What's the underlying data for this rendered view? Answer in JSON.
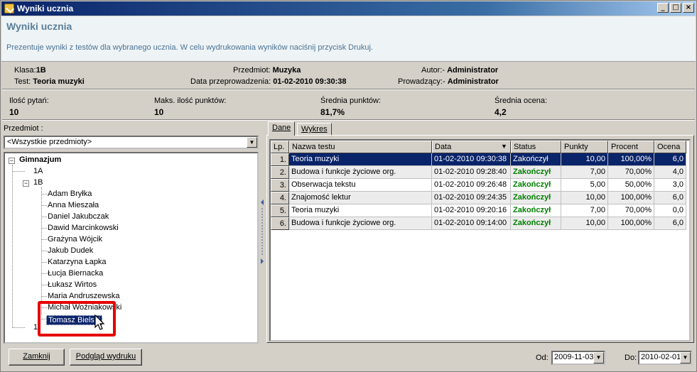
{
  "window": {
    "title": "Wyniki ucznia",
    "min": "_",
    "max": "□",
    "close": "×"
  },
  "header": {
    "title": "Wyniki ucznia",
    "description": "Prezentuje wyniki z testów dla wybranego ucznia. W celu wydrukowania wyników naciśnij przycisk Drukuj."
  },
  "info": {
    "klasa_label": "Klasa:",
    "klasa_value": "1B",
    "test_label": "Test:",
    "test_value": "Teoria muzyki",
    "przedmiot_label": "Przedmiot:",
    "przedmiot_value": "Muzyka",
    "data_label": "Data przeprowadzenia:",
    "data_value": "01-02-2010 09:30:38",
    "autor_label": "Autor:-",
    "autor_value": "Administrator",
    "prowadzacy_label": "Prowadzący:-",
    "prowadzacy_value": "Administrator"
  },
  "stats": {
    "pytan_label": "Ilość pytań:",
    "pytan_value": "10",
    "maks_label": "Maks. ilość punktów:",
    "maks_value": "10",
    "srednia_pkt_label": "Średnia punktów:",
    "srednia_pkt_value": "81,7%",
    "srednia_oc_label": "Średnia ocena:",
    "srednia_oc_value": "4,2"
  },
  "left": {
    "przedmiot_label": "Przedmiot :",
    "przedmiot_selected": "<Wszystkie przedmioty>",
    "tree": {
      "root": "Gimnazjum",
      "classes": [
        "1A",
        "1B"
      ],
      "students": [
        "Adam Bryłka",
        "Anna Mieszała",
        "Daniel Jakubczak",
        "Dawid Marcinkowski",
        "Grażyna Wójcik",
        "Jakub Dudek",
        "Katarzyna Łapka",
        "Łucja Biernacka",
        "Łukasz Wirtos",
        "Maria Andruszewska",
        "Michał Woźniakowski",
        "Tomasz Bielski"
      ],
      "partial_class": "1"
    }
  },
  "tabs": [
    "Dane",
    "Wykres"
  ],
  "grid": {
    "headers": [
      "Lp.",
      "Nazwa testu",
      "Data",
      "Status",
      "Punkty",
      "Procent",
      "Ocena"
    ],
    "rows": [
      [
        "1.",
        "Teoria muzyki",
        "01-02-2010 09:30:38",
        "Zakończył",
        "10,00",
        "100,00%",
        "6,0"
      ],
      [
        "2.",
        "Budowa i funkcje życiowe org.",
        "01-02-2010 09:28:40",
        "Zakończył",
        "7,00",
        "70,00%",
        "4,0"
      ],
      [
        "3.",
        "Obserwacja tekstu",
        "01-02-2010 09:26:48",
        "Zakończył",
        "5,00",
        "50,00%",
        "3,0"
      ],
      [
        "4.",
        "Znajomość lektur",
        "01-02-2010 09:24:35",
        "Zakończył",
        "10,00",
        "100,00%",
        "6,0"
      ],
      [
        "5.",
        "Teoria muzyki",
        "01-02-2010 09:20:16",
        "Zakończył",
        "7,00",
        "70,00%",
        "0,0"
      ],
      [
        "6.",
        "Budowa i funkcje życiowe org.",
        "01-02-2010 09:14:00",
        "Zakończył",
        "10,00",
        "100,00%",
        "6,0"
      ]
    ]
  },
  "footer": {
    "zamknij": "Zamknij",
    "podglad": "Podgląd wydruku",
    "od_label": "Od:",
    "od_value": "2009-11-03",
    "do_label": "Do:",
    "do_value": "2010-02-01"
  },
  "colors": {
    "selection": "#0a246a",
    "status_green": "#008000",
    "highlight_red": "#e60000"
  }
}
